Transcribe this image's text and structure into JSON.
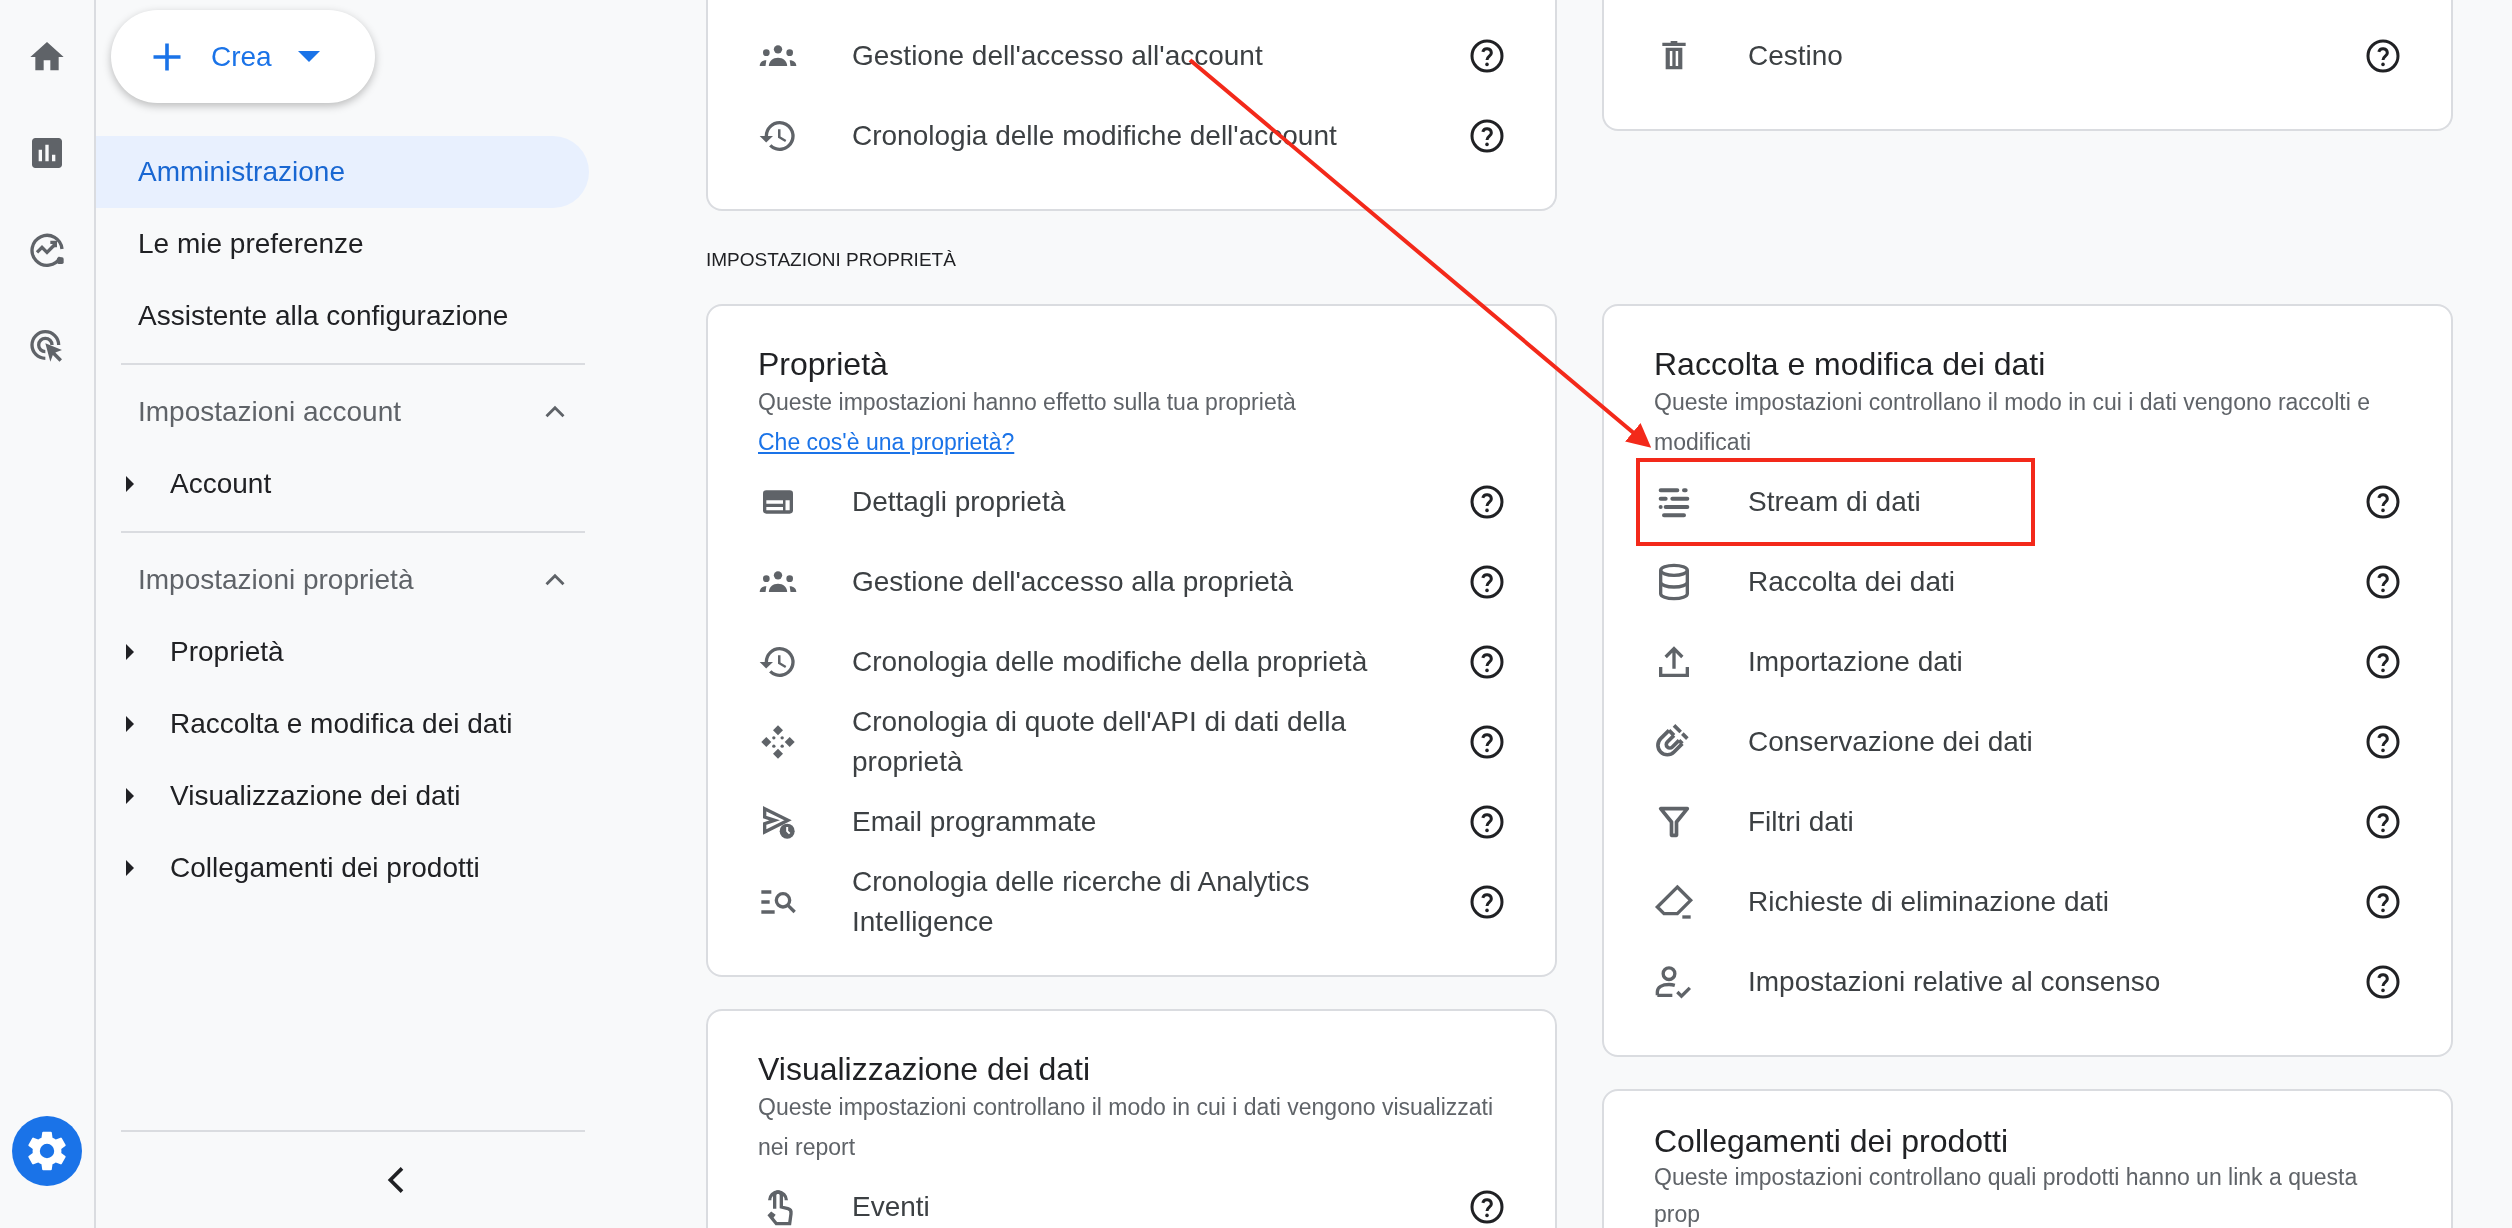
{
  "rail": {
    "items": [
      {
        "selected": false
      },
      {
        "selected": false
      },
      {
        "selected": false
      },
      {
        "selected": false
      }
    ],
    "settings": {
      "selected": true
    }
  },
  "create_button": {
    "label": "Crea"
  },
  "sidebar": {
    "items": [
      {
        "kind": "link",
        "label": "Amministrazione",
        "selected": true
      },
      {
        "kind": "link",
        "label": "Le mie preferenze",
        "selected": false
      },
      {
        "kind": "link",
        "label": "Assistente alla configurazione",
        "selected": false
      },
      {
        "kind": "section",
        "label": "Impostazioni account",
        "expanded": true,
        "children": [
          {
            "label": "Account",
            "expanded": false
          }
        ]
      },
      {
        "kind": "section",
        "label": "Impostazioni proprietà",
        "expanded": true,
        "children": [
          {
            "label": "Proprietà",
            "expanded": false
          },
          {
            "label": "Raccolta e modifica dei dati",
            "expanded": false
          },
          {
            "label": "Visualizzazione dei dati",
            "expanded": false
          },
          {
            "label": "Collegamenti dei prodotti",
            "expanded": false
          }
        ]
      }
    ]
  },
  "account_cards": [
    {
      "rows": [
        {
          "label": "Gestione dell'accesso all'account",
          "highlighted": false
        },
        {
          "label": "Cronologia delle modifiche dell'account",
          "highlighted": false
        }
      ]
    },
    {
      "rows": [
        {
          "label": "Cestino",
          "highlighted": false
        }
      ]
    }
  ],
  "section_label": "IMPOSTAZIONI PROPRIETÀ",
  "left_cards": [
    {
      "title": "Proprietà",
      "description": "Queste impostazioni hanno effetto sulla tua proprietà",
      "link": "Che cos'è una proprietà?",
      "rows": [
        {
          "label": "Dettagli proprietà",
          "highlighted": false
        },
        {
          "label": "Gestione dell'accesso alla proprietà",
          "highlighted": false
        },
        {
          "label": "Cronologia delle modifiche della proprietà",
          "highlighted": false
        },
        {
          "label": "Cronologia di quote dell'API di dati della proprietà",
          "highlighted": false
        },
        {
          "label": "Email programmate",
          "highlighted": false
        },
        {
          "label": "Cronologia delle ricerche di Analytics Intelligence",
          "highlighted": false
        }
      ]
    },
    {
      "title": "Visualizzazione dei dati",
      "description": "Queste impostazioni controllano il modo in cui i dati vengono visualizzati nei report",
      "rows": [
        {
          "label": "Eventi",
          "highlighted": false
        }
      ]
    }
  ],
  "right_cards": [
    {
      "title": "Raccolta e modifica dei dati",
      "description": "Queste impostazioni controllano il modo in cui i dati vengono raccolti e modificati",
      "rows": [
        {
          "label": "Stream di dati",
          "highlighted": true
        },
        {
          "label": "Raccolta dei dati",
          "highlighted": false
        },
        {
          "label": "Importazione dati",
          "highlighted": false
        },
        {
          "label": "Conservazione dei dati",
          "highlighted": false
        },
        {
          "label": "Filtri dati",
          "highlighted": false
        },
        {
          "label": "Richieste di eliminazione dati",
          "highlighted": false
        },
        {
          "label": "Impostazioni relative al consenso",
          "highlighted": false
        }
      ]
    },
    {
      "title": "Collegamenti dei prodotti",
      "description": "Queste impostazioni controllano quali prodotti hanno un link a questa prop"
    }
  ]
}
